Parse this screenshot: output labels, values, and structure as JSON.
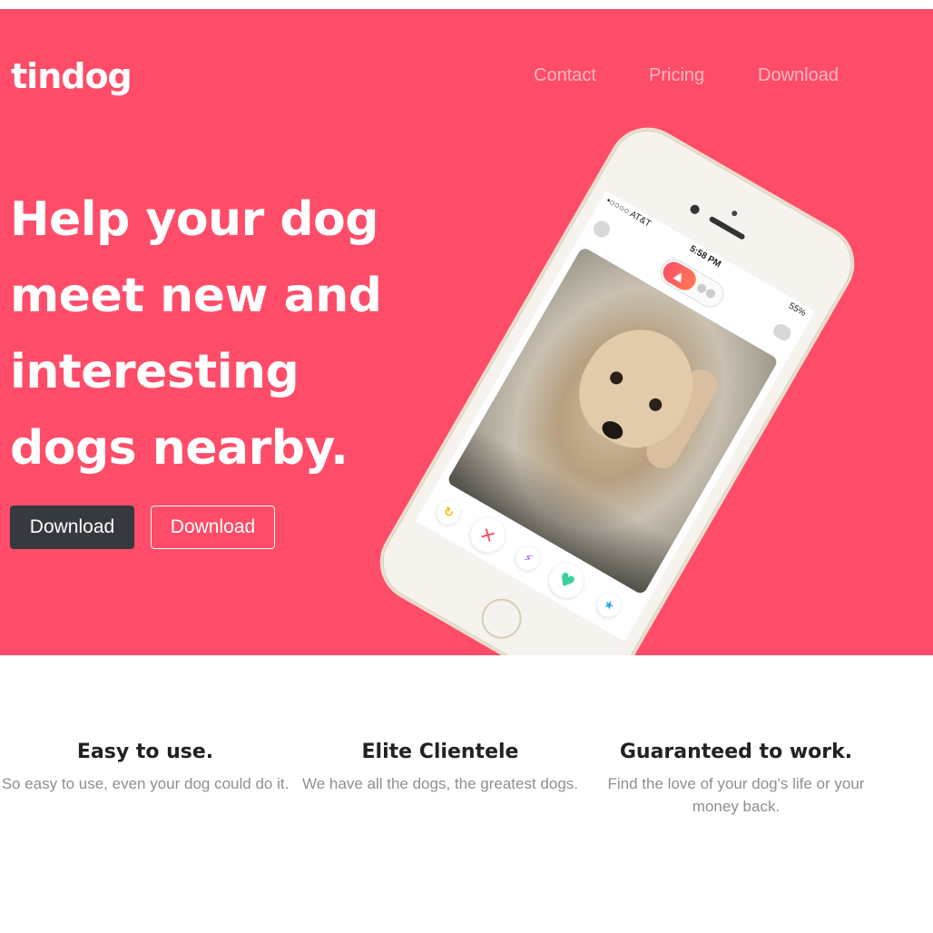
{
  "brand": {
    "name": "tindog"
  },
  "nav": {
    "items": [
      "Contact",
      "Pricing",
      "Download"
    ]
  },
  "hero": {
    "headline_lines": [
      "Help your dog",
      "meet new and",
      "interesting",
      "dogs nearby."
    ],
    "buttons": {
      "primary": "Download",
      "secondary": "Download"
    },
    "colors": {
      "background": "#ff4c68",
      "primary_button": "#343a40"
    }
  },
  "phone": {
    "carrier": "•○○○○ AT&T",
    "time": "5:58 PM",
    "battery": "55%",
    "toggle_icon": "flame-icon",
    "action_icons": [
      "rewind-icon",
      "close-icon",
      "bolt-icon",
      "heart-icon",
      "star-icon"
    ]
  },
  "features": [
    {
      "title": "Easy to use.",
      "text": "So easy to use, even your dog could do it."
    },
    {
      "title": "Elite Clientele",
      "text": "We have all the dogs, the greatest dogs."
    },
    {
      "title": "Guaranteed to work.",
      "text": "Find the love of your dog's life or your money back."
    }
  ]
}
